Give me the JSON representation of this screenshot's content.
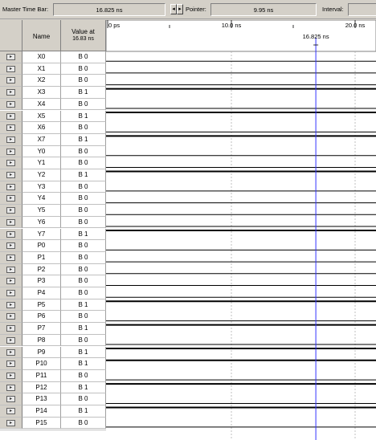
{
  "toolbar": {
    "master_time_bar_label": "Master Time Bar:",
    "master_time_bar_value": "16.825 ns",
    "prev_arrow": "◂",
    "next_arrow": "▸",
    "pointer_label": "Pointer:",
    "pointer_value": "9.95 ns",
    "interval_label": "Interval:",
    "interval_value": ""
  },
  "table": {
    "name_header": "Name",
    "value_header_line1": "Value at",
    "value_header_line2": "16.83 ns"
  },
  "timeline": {
    "tick_0": "0 ps",
    "tick_10": "10.0 ns",
    "tick_20": "20.0 ns",
    "cursor_label": "16.825 ns"
  },
  "signals": [
    {
      "name": "X0",
      "value": "B 0",
      "level": 0
    },
    {
      "name": "X1",
      "value": "B 0",
      "level": 0
    },
    {
      "name": "X2",
      "value": "B 0",
      "level": 0
    },
    {
      "name": "X3",
      "value": "B 1",
      "level": 1
    },
    {
      "name": "X4",
      "value": "B 0",
      "level": 0
    },
    {
      "name": "X5",
      "value": "B 1",
      "level": 1
    },
    {
      "name": "X6",
      "value": "B 0",
      "level": 0
    },
    {
      "name": "X7",
      "value": "B 1",
      "level": 1
    },
    {
      "name": "Y0",
      "value": "B 0",
      "level": 0
    },
    {
      "name": "Y1",
      "value": "B 0",
      "level": 0
    },
    {
      "name": "Y2",
      "value": "B 1",
      "level": 1
    },
    {
      "name": "Y3",
      "value": "B 0",
      "level": 0
    },
    {
      "name": "Y4",
      "value": "B 0",
      "level": 0
    },
    {
      "name": "Y5",
      "value": "B 0",
      "level": 0
    },
    {
      "name": "Y6",
      "value": "B 0",
      "level": 0
    },
    {
      "name": "Y7",
      "value": "B 1",
      "level": 1
    },
    {
      "name": "P0",
      "value": "B 0",
      "level": 0
    },
    {
      "name": "P1",
      "value": "B 0",
      "level": 0
    },
    {
      "name": "P2",
      "value": "B 0",
      "level": 0
    },
    {
      "name": "P3",
      "value": "B 0",
      "level": 0
    },
    {
      "name": "P4",
      "value": "B 0",
      "level": 0
    },
    {
      "name": "P5",
      "value": "B 1",
      "level": 1
    },
    {
      "name": "P6",
      "value": "B 0",
      "level": 0
    },
    {
      "name": "P7",
      "value": "B 1",
      "level": 1
    },
    {
      "name": "P8",
      "value": "B 0",
      "level": 0
    },
    {
      "name": "P9",
      "value": "B 1",
      "level": 1
    },
    {
      "name": "P10",
      "value": "B 1",
      "level": 1
    },
    {
      "name": "P11",
      "value": "B 0",
      "level": 0
    },
    {
      "name": "P12",
      "value": "B 1",
      "level": 1
    },
    {
      "name": "P13",
      "value": "B 0",
      "level": 0
    },
    {
      "name": "P14",
      "value": "B 1",
      "level": 1
    },
    {
      "name": "P15",
      "value": "B 0",
      "level": 0
    }
  ],
  "colors": {
    "cursor": "#3333ff",
    "waveform": "#000000",
    "grid": "#b0b0b0"
  }
}
